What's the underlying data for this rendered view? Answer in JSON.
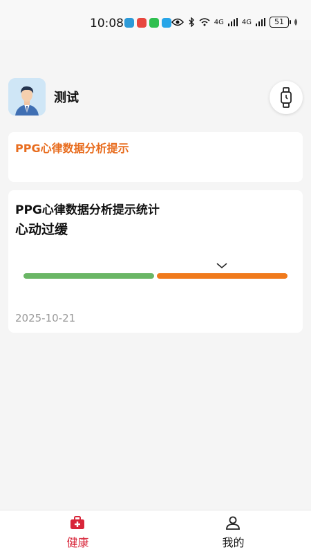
{
  "status_bar": {
    "time": "10:08",
    "network": "4G",
    "battery": "51"
  },
  "profile": {
    "name": "测试"
  },
  "card1": {
    "title": "PPG心律数据分析提示"
  },
  "card2": {
    "title": "PPG心律数据分析提示统计",
    "status": "心动过缓",
    "date": "2025-10-21",
    "marker_position_fraction": 0.75
  },
  "nav": {
    "health_label": "健康",
    "mine_label": "我的"
  },
  "colors": {
    "accent_orange": "#e86d1f",
    "bar_green": "#6ab665",
    "bar_orange": "#f07a1c",
    "nav_active": "#d8263a"
  }
}
